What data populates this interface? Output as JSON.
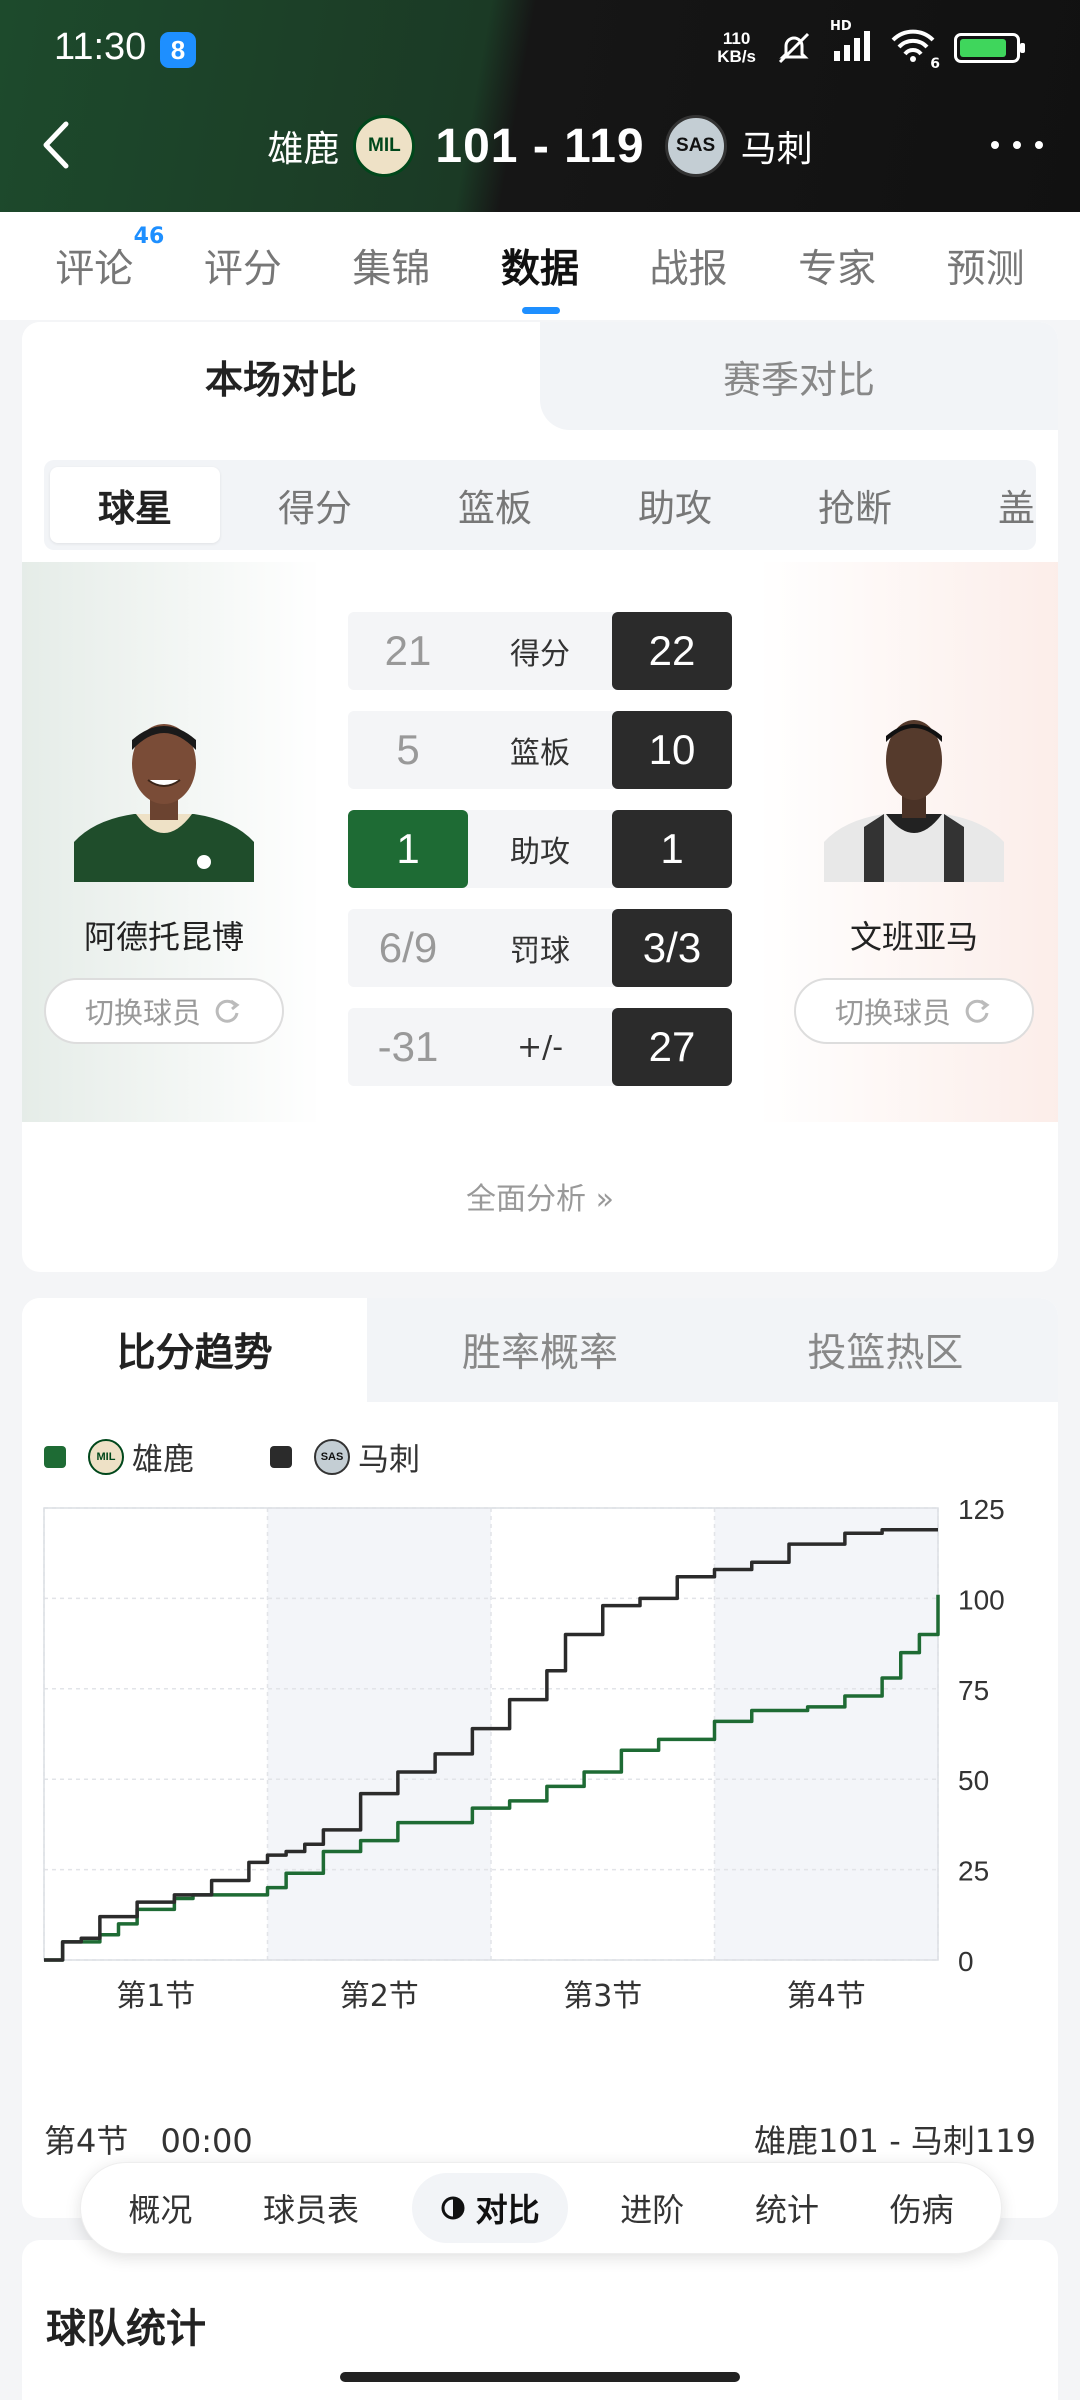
{
  "status_bar": {
    "time": "11:30",
    "badge": "8",
    "net_speed_value": "110",
    "net_speed_unit": "KB/s",
    "signal_label": "HD",
    "wifi_label": "6",
    "battery_icon": "battery-charging-icon"
  },
  "header": {
    "home_team": "雄鹿",
    "home_logo": "MIL",
    "score": "101 - 119",
    "away_logo": "SAS",
    "away_team": "马刺"
  },
  "top_tabs": [
    {
      "label": "评论",
      "sup": "46"
    },
    {
      "label": "评分"
    },
    {
      "label": "集锦"
    },
    {
      "label": "数据",
      "active": true
    },
    {
      "label": "战报"
    },
    {
      "label": "专家"
    },
    {
      "label": "预测"
    }
  ],
  "compare": {
    "segment": [
      "本场对比",
      "赛季对比"
    ],
    "subtabs": [
      "球星",
      "得分",
      "篮板",
      "助攻",
      "抢断",
      "盖帽"
    ],
    "left_player": {
      "name": "阿德托昆博",
      "switch_label": "切换球员"
    },
    "right_player": {
      "name": "文班亚马",
      "switch_label": "切换球员"
    },
    "rows": [
      {
        "label": "得分",
        "left": "21",
        "right": "22"
      },
      {
        "label": "篮板",
        "left": "5",
        "right": "10"
      },
      {
        "label": "助攻",
        "left": "1",
        "right": "1"
      },
      {
        "label": "罚球",
        "left": "6/9",
        "right": "3/3"
      },
      {
        "label": "+/-",
        "left": "-31",
        "right": "27"
      }
    ],
    "analysis_link": "全面分析 »"
  },
  "trend": {
    "tabs": [
      "比分趋势",
      "胜率概率",
      "投篮热区"
    ],
    "legend": [
      {
        "name": "雄鹿",
        "color": "#1e6b34",
        "logo": "MIL"
      },
      {
        "name": "马刺",
        "color": "#2b2b2b",
        "logo": "SAS"
      }
    ],
    "period_label": "第4节",
    "clock": "00:00",
    "final_text": "雄鹿101 - 马刺119"
  },
  "chart_data": {
    "type": "line",
    "x_categories": [
      "第1节",
      "第2节",
      "第3节",
      "第4节"
    ],
    "xlim": [
      0,
      48
    ],
    "ylim": [
      0,
      125
    ],
    "y_ticks": [
      0,
      25,
      50,
      75,
      100,
      125
    ],
    "grid": true,
    "legend_position": "top-left",
    "series": [
      {
        "name": "雄鹿",
        "color": "#1e6b34",
        "points": [
          [
            0,
            0
          ],
          [
            1,
            5
          ],
          [
            3,
            7
          ],
          [
            4,
            10
          ],
          [
            5,
            14
          ],
          [
            7,
            17
          ],
          [
            8,
            18
          ],
          [
            10,
            18
          ],
          [
            12,
            20
          ],
          [
            13,
            24
          ],
          [
            15,
            30
          ],
          [
            17,
            33
          ],
          [
            19,
            38
          ],
          [
            21,
            38
          ],
          [
            23,
            42
          ],
          [
            25,
            44
          ],
          [
            27,
            48
          ],
          [
            29,
            52
          ],
          [
            31,
            58
          ],
          [
            33,
            61
          ],
          [
            36,
            66
          ],
          [
            38,
            69
          ],
          [
            41,
            70
          ],
          [
            43,
            73
          ],
          [
            45,
            78
          ],
          [
            46,
            85
          ],
          [
            47,
            90
          ],
          [
            48,
            101
          ]
        ]
      },
      {
        "name": "马刺",
        "color": "#2b2b2b",
        "points": [
          [
            0,
            0
          ],
          [
            1,
            5
          ],
          [
            2,
            6
          ],
          [
            3,
            12
          ],
          [
            5,
            16
          ],
          [
            7,
            18
          ],
          [
            9,
            22
          ],
          [
            11,
            27
          ],
          [
            12,
            29
          ],
          [
            13,
            30
          ],
          [
            14,
            32
          ],
          [
            15,
            36
          ],
          [
            17,
            46
          ],
          [
            19,
            52
          ],
          [
            21,
            57
          ],
          [
            23,
            64
          ],
          [
            25,
            72
          ],
          [
            27,
            80
          ],
          [
            28,
            90
          ],
          [
            30,
            98
          ],
          [
            32,
            100
          ],
          [
            34,
            106
          ],
          [
            36,
            108
          ],
          [
            38,
            110
          ],
          [
            40,
            115
          ],
          [
            43,
            118
          ],
          [
            45,
            119
          ],
          [
            48,
            119
          ]
        ]
      }
    ]
  },
  "bottom_bar": {
    "items": [
      "概况",
      "球员表",
      "对比",
      "进阶",
      "统计",
      "伤病"
    ],
    "active_index": 2
  },
  "team_stats": {
    "title": "球队统计"
  }
}
